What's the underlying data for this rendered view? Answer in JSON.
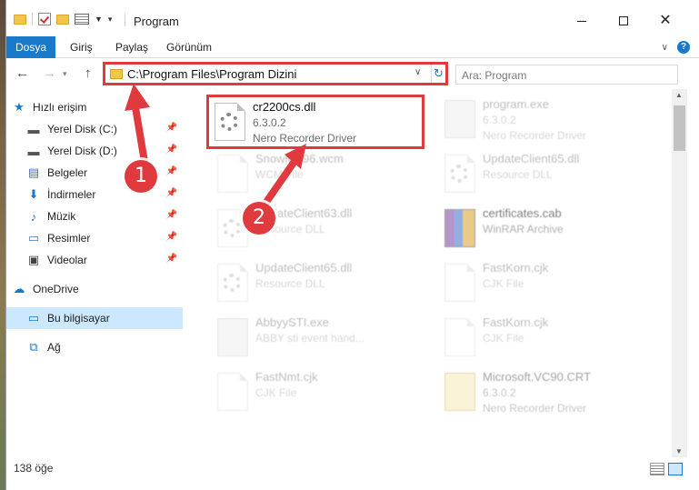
{
  "window": {
    "title": "Program",
    "accent": "#1979ca",
    "highlight_color": "#e03a3e"
  },
  "ribbon": {
    "tabs": [
      "Dosya",
      "Giriş",
      "Paylaş",
      "Görünüm"
    ]
  },
  "nav": {
    "address": "C:\\Program Files\\Program Dizini",
    "search_placeholder": "Ara: Program"
  },
  "sidebar": {
    "items": [
      {
        "label": "Hızlı erişim",
        "icon": "star-icon"
      },
      {
        "label": "Yerel Disk (C:)",
        "icon": "drive-icon"
      },
      {
        "label": "Yerel Disk (D:)",
        "icon": "drive-icon"
      },
      {
        "label": "Belgeler",
        "icon": "documents-icon"
      },
      {
        "label": "İndirmeler",
        "icon": "download-icon"
      },
      {
        "label": "Müzik",
        "icon": "music-icon"
      },
      {
        "label": "Resimler",
        "icon": "pictures-icon"
      },
      {
        "label": "Videolar",
        "icon": "videos-icon"
      },
      {
        "label": "OneDrive",
        "icon": "cloud-icon"
      },
      {
        "label": "Bu bilgisayar",
        "icon": "computer-icon"
      },
      {
        "label": "Ağ",
        "icon": "network-icon"
      }
    ]
  },
  "files": [
    {
      "name": "cr2200cs.dll",
      "line1": "6.3.0.2",
      "line2": "Nero Recorder Driver",
      "icon": "gear-dll-icon"
    },
    {
      "name": "program.exe",
      "line1": "6.3.0.2",
      "line2": "Nero Recorder Driver",
      "icon": "exe-icon"
    },
    {
      "name": "SnowMP96.wcm",
      "line1": "WCM File",
      "line2": "",
      "icon": "file-icon"
    },
    {
      "name": "UpdateClient65.dll",
      "line1": "Resource DLL",
      "line2": "",
      "icon": "gear-dll-icon"
    },
    {
      "name": "UpdateClient63.dll",
      "line1": "Resource DLL",
      "line2": "",
      "icon": "gear-dll-icon"
    },
    {
      "name": "certificates.cab",
      "line1": "WinRAR Archive",
      "line2": "",
      "icon": "archive-icon"
    },
    {
      "name": "UpdateClient65.dll",
      "line1": "Resource DLL",
      "line2": "",
      "icon": "gear-dll-icon"
    },
    {
      "name": "FastKorn.cjk",
      "line1": "CJK File",
      "line2": "",
      "icon": "file-icon"
    },
    {
      "name": "AbbyySTI.exe",
      "line1": "ABBY sti event hand...",
      "line2": "",
      "icon": "exe-icon"
    },
    {
      "name": "FastKorn.cjk",
      "line1": "CJK File",
      "line2": "",
      "icon": "file-icon"
    },
    {
      "name": "FastNmt.cjk",
      "line1": "CJK File",
      "line2": "",
      "icon": "file-icon"
    },
    {
      "name": "Microsoft.VC90.CRT",
      "line1": "6.3.0.2",
      "line2": "Nero Recorder Driver",
      "icon": "certificate-icon"
    }
  ],
  "status": {
    "count": "138 öğe"
  },
  "markers": {
    "one": "1",
    "two": "2"
  }
}
